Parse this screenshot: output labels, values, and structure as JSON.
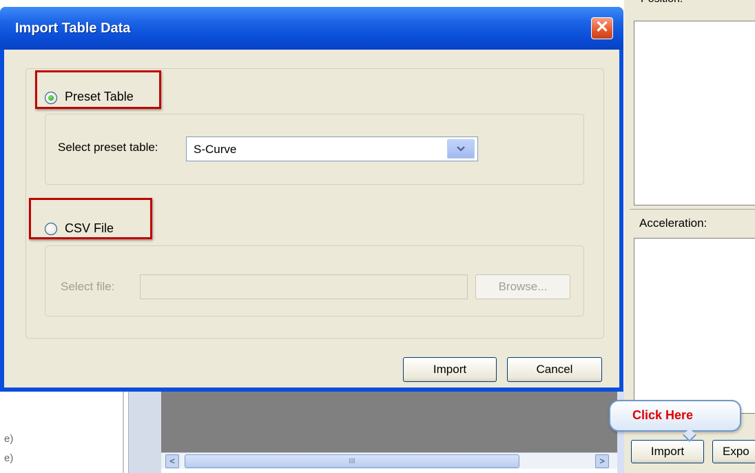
{
  "background": {
    "position_label": "Position:",
    "acceleration_label": "Acceleration:",
    "import_label": "Import",
    "export_label": "Expo",
    "left_fragment_1": "e)",
    "left_fragment_2": "e)",
    "scroll_left": "<",
    "scroll_right": ">",
    "scroll_grip": "III"
  },
  "dialog": {
    "title": "Import Table Data",
    "close_glyph": "✕",
    "preset_option": {
      "label": "Preset Table",
      "selected": true
    },
    "preset_select_label": "Select preset table:",
    "preset_select_value": "S-Curve",
    "csv_option": {
      "label": "CSV File",
      "selected": false
    },
    "file_label": "Select file:",
    "file_value": "",
    "browse_label": "Browse...",
    "import_label": "Import",
    "cancel_label": "Cancel"
  },
  "callout": {
    "text": "Click Here"
  },
  "colors": {
    "highlight": "#c00000",
    "callout_text": "#e00000",
    "titlebar": "#0a4edc"
  },
  "icons": {
    "dropdown": "chevron-down-icon",
    "close": "close-icon"
  }
}
